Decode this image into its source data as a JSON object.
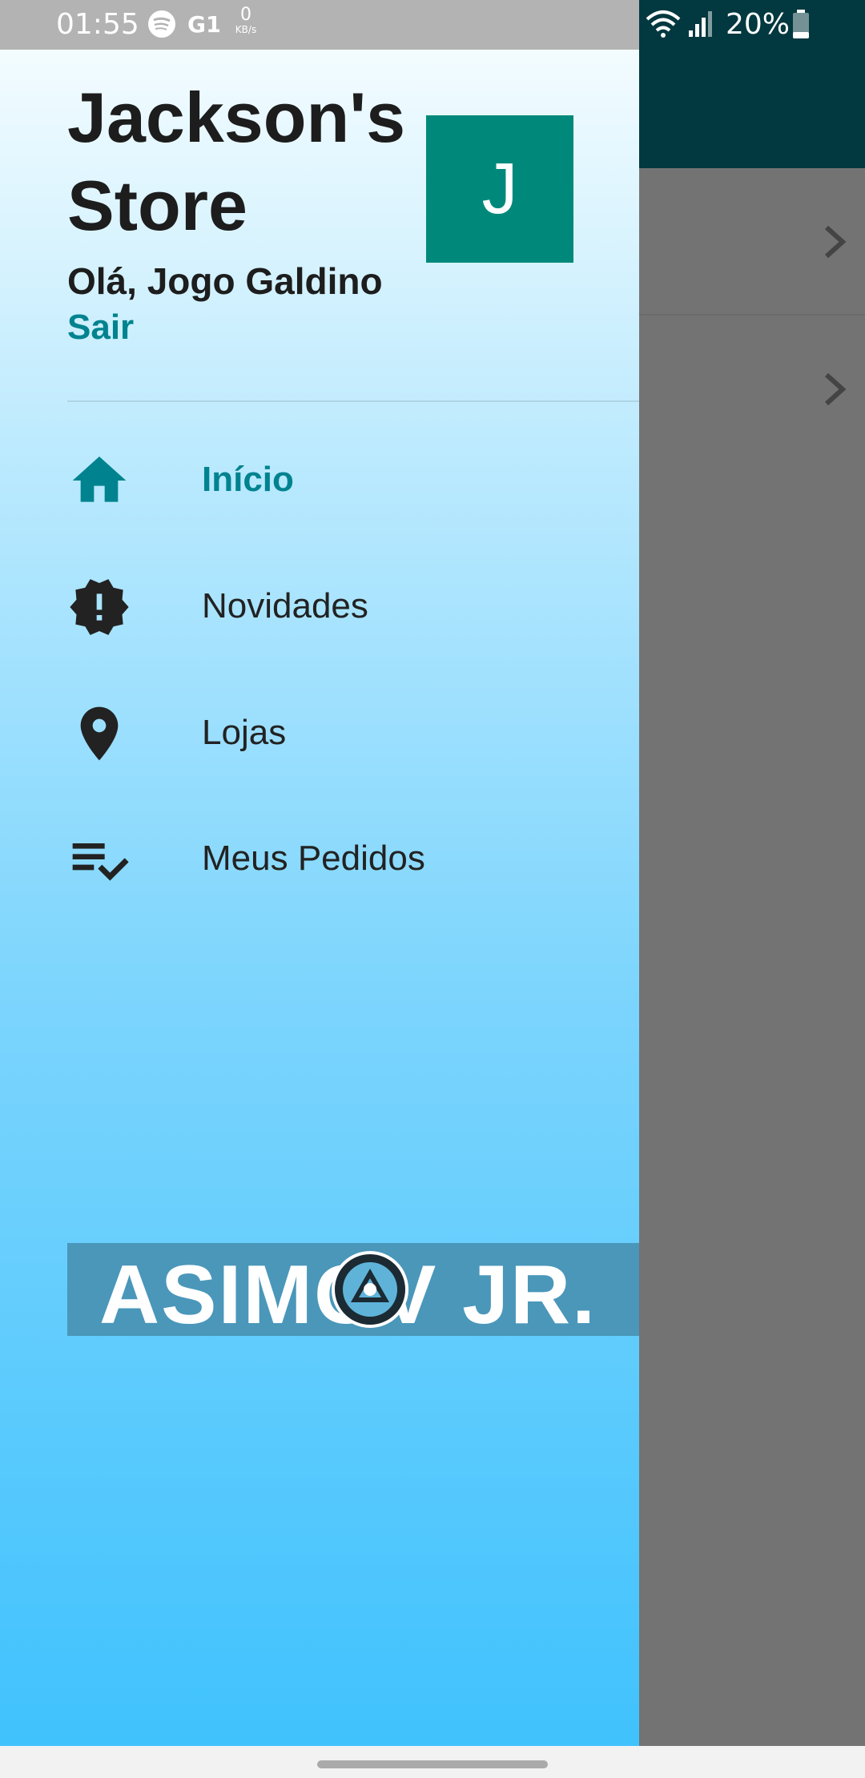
{
  "status_bar": {
    "time": "01:55",
    "net_speed_value": "0",
    "net_speed_unit": "KB/s",
    "battery": "20%"
  },
  "drawer": {
    "store_title": "Jackson's Store",
    "avatar_letter": "J",
    "greeting": "Olá, Jogo Galdino",
    "logout_label": "Sair",
    "items": [
      {
        "label": "Início",
        "icon": "home-icon",
        "active": true
      },
      {
        "label": "Novidades",
        "icon": "new-releases-icon",
        "active": false
      },
      {
        "label": "Lojas",
        "icon": "location-pin-icon",
        "active": false
      },
      {
        "label": "Meus Pedidos",
        "icon": "playlist-check-icon",
        "active": false
      }
    ],
    "logo_text": "ASIMOV JR."
  },
  "colors": {
    "accent": "#00838f",
    "avatar_bg": "#00897b",
    "app_bar": "#02383f"
  }
}
